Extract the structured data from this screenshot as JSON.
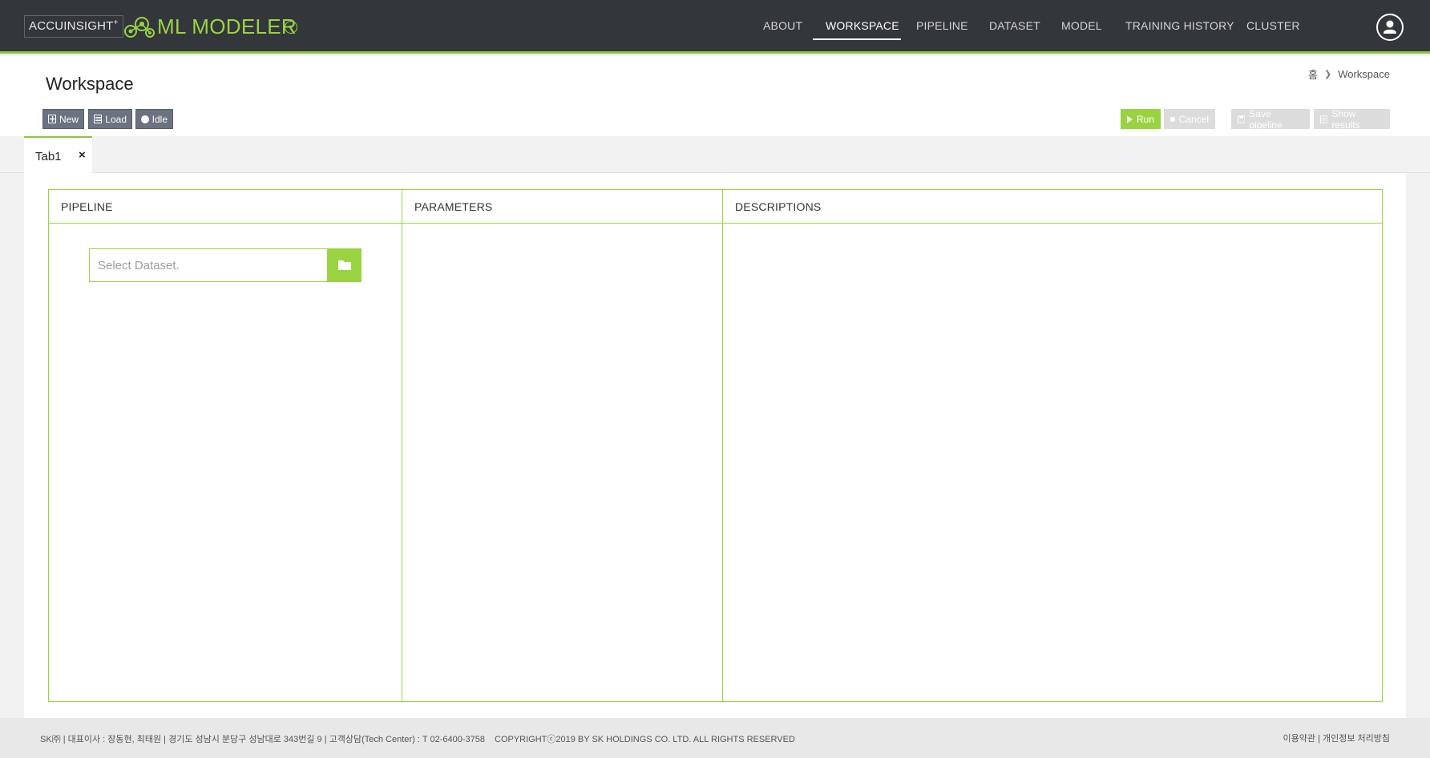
{
  "topbar": {
    "brand": "ACCUINSIGHT",
    "brand_sup": "+",
    "app_title": "ML MODELER",
    "nav": [
      {
        "label": "ABOUT"
      },
      {
        "label": "WORKSPACE",
        "active": true
      },
      {
        "label": "PIPELINE"
      },
      {
        "label": "DATASET"
      },
      {
        "label": "MODEL"
      },
      {
        "label": "TRAINING HISTORY"
      },
      {
        "label": "CLUSTER"
      }
    ]
  },
  "header": {
    "title": "Workspace",
    "breadcrumb": {
      "home": "홈",
      "current": "Workspace"
    },
    "left_buttons": {
      "new": "New",
      "load": "Load",
      "idle": "Idle"
    },
    "right_buttons": {
      "run": "Run",
      "cancel": "Cancel",
      "save_pipeline": "Save pipeline",
      "show_results": "Show results"
    }
  },
  "tabs": [
    {
      "label": "Tab1",
      "close": "×"
    }
  ],
  "panels": {
    "pipeline": "PIPELINE",
    "parameters": "PARAMETERS",
    "descriptions": "DESCRIPTIONS"
  },
  "dataset": {
    "placeholder": "Select Dataset."
  },
  "footer": {
    "company": "SK㈜ | 대표이사 : 장동현, 최태원 | 경기도 성남시 분당구 성남대로 343번길 9 | 고객상담(Tech Center) : T 02-6400-3758",
    "copyright": "COPYRIGHTⓒ2019 BY SK HOLDINGS CO. LTD. ALL RIGHTS RESERVED",
    "links": "이용약관 | 개인정보 처리방침"
  },
  "colors": {
    "accent": "#9ad342",
    "topbar": "#33363b",
    "button_gray": "#6b7280"
  }
}
